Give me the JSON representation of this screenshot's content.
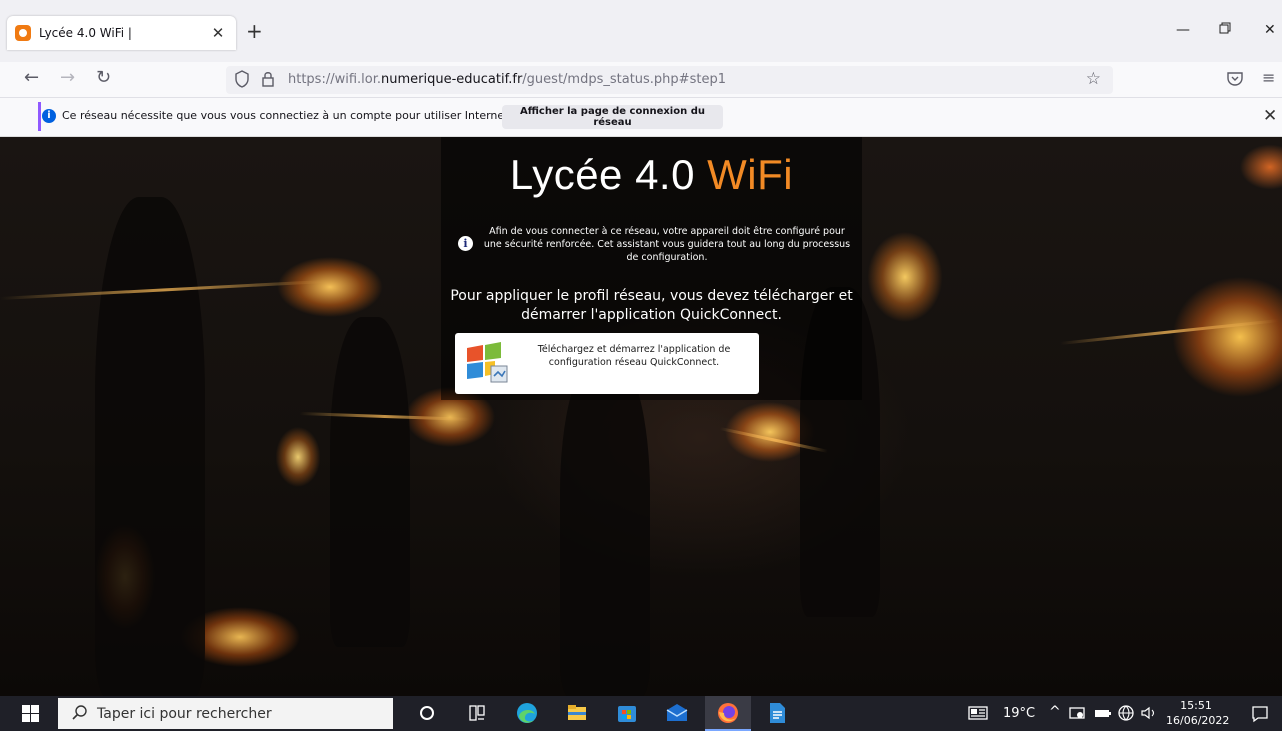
{
  "browser": {
    "tab": {
      "title": "Lycée 4.0 WiFi |"
    },
    "url": {
      "prefix": "https://wifi.lor.",
      "domain": "numerique-educatif.fr",
      "path": "/guest/mdps_status.php#step1"
    },
    "notification": {
      "text": "Ce réseau nécessite que vous vous connectiez à un compte pour utiliser Internet.",
      "button_label": "Afficher la page de connexion du réseau"
    }
  },
  "page": {
    "title_main": "Lycée 4.0",
    "title_accent": "WiFi",
    "accent_color": "#f28a25",
    "info_text": "Afin de vous connecter à ce réseau, votre appareil doit être configuré pour une sécurité renforcée. Cet assistant vous guidera tout au long du processus de configuration.",
    "instruction": "Pour appliquer le profil réseau, vous devez télécharger et démarrer l'application QuickConnect.",
    "quickconnect_button": "Téléchargez et démarrez l'application de configuration réseau QuickConnect."
  },
  "taskbar": {
    "search_placeholder": "Taper ici pour rechercher",
    "temperature": "19°C",
    "time": "15:51",
    "date": "16/06/2022"
  }
}
